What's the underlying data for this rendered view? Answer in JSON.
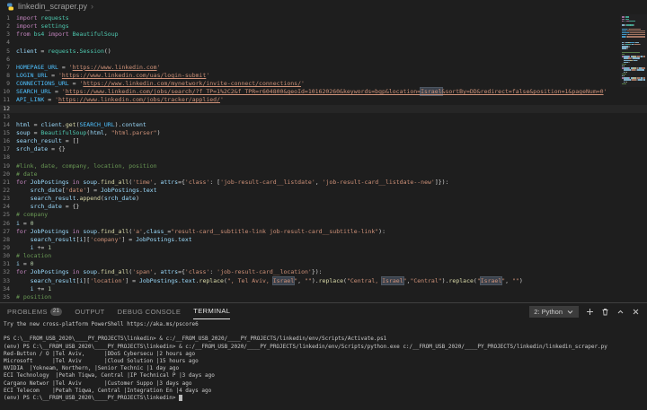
{
  "breadcrumb": {
    "file": "linkedin_scraper.py",
    "separator": "›"
  },
  "colors": {
    "background": "#1e1e1e",
    "keyword": "#c586c0",
    "module": "#4ec9b0",
    "function": "#dcdcaa",
    "variable": "#9cdcfe",
    "constant": "#4fc1ff",
    "string": "#ce9178",
    "number": "#b5cea8",
    "comment": "#6a9955",
    "plain": "#d4d4d4",
    "line_number": "#858585",
    "terminal_text": "#cccccc"
  },
  "editor": {
    "active_line": 12,
    "lines": [
      {
        "n": 1,
        "t": [
          [
            "k",
            "import"
          ],
          [
            "p",
            " "
          ],
          [
            "m",
            "requests"
          ]
        ]
      },
      {
        "n": 2,
        "t": [
          [
            "k",
            "import"
          ],
          [
            "p",
            " "
          ],
          [
            "m",
            "settings"
          ]
        ]
      },
      {
        "n": 3,
        "t": [
          [
            "k",
            "from"
          ],
          [
            "p",
            " "
          ],
          [
            "m",
            "bs4"
          ],
          [
            "p",
            " "
          ],
          [
            "k",
            "import"
          ],
          [
            "p",
            " "
          ],
          [
            "m",
            "BeautifulSoup"
          ]
        ]
      },
      {
        "n": 4,
        "t": []
      },
      {
        "n": 5,
        "t": [
          [
            "v",
            "client"
          ],
          [
            "p",
            " = "
          ],
          [
            "m",
            "requests"
          ],
          [
            "p",
            "."
          ],
          [
            "m",
            "Session"
          ],
          [
            "p",
            "()"
          ]
        ]
      },
      {
        "n": 6,
        "t": []
      },
      {
        "n": 7,
        "t": [
          [
            "c",
            "HOMEPAGE_URL"
          ],
          [
            "p",
            " = "
          ],
          [
            "s",
            "'"
          ],
          [
            "u",
            "https://www.linkedin.com"
          ],
          [
            "s",
            "'"
          ]
        ]
      },
      {
        "n": 8,
        "t": [
          [
            "c",
            "LOGIN_URL"
          ],
          [
            "p",
            " = "
          ],
          [
            "s",
            "'"
          ],
          [
            "u",
            "https://www.linkedin.com/uas/login-submit"
          ],
          [
            "s",
            "'"
          ]
        ]
      },
      {
        "n": 9,
        "t": [
          [
            "c",
            "CONNECTIONS_URL"
          ],
          [
            "p",
            " = "
          ],
          [
            "s",
            "'"
          ],
          [
            "u",
            "https://www.linkedin.com/mynetwork/invite-connect/connections/"
          ],
          [
            "s",
            "'"
          ]
        ]
      },
      {
        "n": 10,
        "t": [
          [
            "c",
            "SEARCH_URL"
          ],
          [
            "p",
            " = "
          ],
          [
            "s",
            "'"
          ],
          [
            "u",
            "https://www.linkedin.com/jobs/search/?f_TP=1%2C2&f_TPR=r604800&geoId=101620260&keywords=bgp&location="
          ],
          [
            "w",
            "Israel"
          ],
          [
            "u",
            "&sortBy=DD&redirect=false&position=1&pageNum=0"
          ],
          [
            "s",
            "'"
          ]
        ]
      },
      {
        "n": 11,
        "t": [
          [
            "c",
            "API_LINK"
          ],
          [
            "p",
            " = "
          ],
          [
            "s",
            "'"
          ],
          [
            "u",
            "https://www.linkedin.com/jobs/tracker/applied/"
          ],
          [
            "s",
            "'"
          ]
        ]
      },
      {
        "n": 12,
        "t": []
      },
      {
        "n": 13,
        "t": []
      },
      {
        "n": 14,
        "t": [
          [
            "v",
            "html"
          ],
          [
            "p",
            " = "
          ],
          [
            "v",
            "client"
          ],
          [
            "p",
            "."
          ],
          [
            "f",
            "get"
          ],
          [
            "p",
            "("
          ],
          [
            "c",
            "SEARCH_URL"
          ],
          [
            "p",
            ")."
          ],
          [
            "v",
            "content"
          ]
        ]
      },
      {
        "n": 15,
        "t": [
          [
            "v",
            "soup"
          ],
          [
            "p",
            " = "
          ],
          [
            "m",
            "BeautifulSoup"
          ],
          [
            "p",
            "("
          ],
          [
            "v",
            "html"
          ],
          [
            "p",
            ", "
          ],
          [
            "s",
            "\"html.parser\""
          ],
          [
            "p",
            ")"
          ]
        ]
      },
      {
        "n": 16,
        "t": [
          [
            "v",
            "search_result"
          ],
          [
            "p",
            " = []"
          ]
        ]
      },
      {
        "n": 17,
        "t": [
          [
            "v",
            "srch_date"
          ],
          [
            "p",
            " = {}"
          ]
        ]
      },
      {
        "n": 18,
        "t": []
      },
      {
        "n": 19,
        "t": [
          [
            "o",
            "#link, date, company, location, position"
          ]
        ]
      },
      {
        "n": 20,
        "t": [
          [
            "o",
            "# date"
          ]
        ]
      },
      {
        "n": 21,
        "t": [
          [
            "k",
            "for"
          ],
          [
            "p",
            " "
          ],
          [
            "v",
            "JobPostings"
          ],
          [
            "p",
            " "
          ],
          [
            "k",
            "in"
          ],
          [
            "p",
            " "
          ],
          [
            "v",
            "soup"
          ],
          [
            "p",
            "."
          ],
          [
            "f",
            "find_all"
          ],
          [
            "p",
            "("
          ],
          [
            "s",
            "'time'"
          ],
          [
            "p",
            ", "
          ],
          [
            "v",
            "attrs"
          ],
          [
            "p",
            "={"
          ],
          [
            "s",
            "'class'"
          ],
          [
            "p",
            ": ["
          ],
          [
            "s",
            "'job-result-card__listdate'"
          ],
          [
            "p",
            ", "
          ],
          [
            "s",
            "'job-result-card__listdate--new'"
          ],
          [
            "p",
            "]}):"
          ]
        ]
      },
      {
        "n": 22,
        "t": [
          [
            "p",
            "    "
          ],
          [
            "v",
            "srch_date"
          ],
          [
            "p",
            "["
          ],
          [
            "s",
            "'date'"
          ],
          [
            "p",
            "] = "
          ],
          [
            "v",
            "JobPostings"
          ],
          [
            "p",
            "."
          ],
          [
            "v",
            "text"
          ]
        ]
      },
      {
        "n": 23,
        "t": [
          [
            "p",
            "    "
          ],
          [
            "v",
            "search_result"
          ],
          [
            "p",
            "."
          ],
          [
            "f",
            "append"
          ],
          [
            "p",
            "("
          ],
          [
            "v",
            "srch_date"
          ],
          [
            "p",
            ")"
          ]
        ]
      },
      {
        "n": 24,
        "t": [
          [
            "p",
            "    "
          ],
          [
            "v",
            "srch_date"
          ],
          [
            "p",
            " = {}"
          ]
        ]
      },
      {
        "n": 25,
        "t": [
          [
            "o",
            "# company"
          ]
        ]
      },
      {
        "n": 26,
        "t": [
          [
            "v",
            "i"
          ],
          [
            "p",
            " = "
          ],
          [
            "n2",
            "0"
          ]
        ]
      },
      {
        "n": 27,
        "t": [
          [
            "k",
            "for"
          ],
          [
            "p",
            " "
          ],
          [
            "v",
            "JobPostings"
          ],
          [
            "p",
            " "
          ],
          [
            "k",
            "in"
          ],
          [
            "p",
            " "
          ],
          [
            "v",
            "soup"
          ],
          [
            "p",
            "."
          ],
          [
            "f",
            "find_all"
          ],
          [
            "p",
            "("
          ],
          [
            "s",
            "'a'"
          ],
          [
            "p",
            ","
          ],
          [
            "v",
            "class_"
          ],
          [
            "p",
            "="
          ],
          [
            "s",
            "\"result-card__subtitle-link job-result-card__subtitle-link\""
          ],
          [
            "p",
            "):"
          ]
        ]
      },
      {
        "n": 28,
        "t": [
          [
            "p",
            "    "
          ],
          [
            "v",
            "search_result"
          ],
          [
            "p",
            "["
          ],
          [
            "v",
            "i"
          ],
          [
            "p",
            "]["
          ],
          [
            "s",
            "'company'"
          ],
          [
            "p",
            "] = "
          ],
          [
            "v",
            "JobPostings"
          ],
          [
            "p",
            "."
          ],
          [
            "v",
            "text"
          ]
        ]
      },
      {
        "n": 29,
        "t": [
          [
            "p",
            "    "
          ],
          [
            "v",
            "i"
          ],
          [
            "p",
            " += "
          ],
          [
            "n2",
            "1"
          ]
        ]
      },
      {
        "n": 30,
        "t": [
          [
            "o",
            "# location"
          ]
        ]
      },
      {
        "n": 31,
        "t": [
          [
            "v",
            "i"
          ],
          [
            "p",
            " = "
          ],
          [
            "n2",
            "0"
          ]
        ]
      },
      {
        "n": 32,
        "t": [
          [
            "k",
            "for"
          ],
          [
            "p",
            " "
          ],
          [
            "v",
            "JobPostings"
          ],
          [
            "p",
            " "
          ],
          [
            "k",
            "in"
          ],
          [
            "p",
            " "
          ],
          [
            "v",
            "soup"
          ],
          [
            "p",
            "."
          ],
          [
            "f",
            "find_all"
          ],
          [
            "p",
            "("
          ],
          [
            "s",
            "'span'"
          ],
          [
            "p",
            ", "
          ],
          [
            "v",
            "attrs"
          ],
          [
            "p",
            "={"
          ],
          [
            "s",
            "'class'"
          ],
          [
            "p",
            ": "
          ],
          [
            "s",
            "'job-result-card__location'"
          ],
          [
            "p",
            "}):"
          ]
        ]
      },
      {
        "n": 33,
        "t": [
          [
            "p",
            "    "
          ],
          [
            "v",
            "search_result"
          ],
          [
            "p",
            "["
          ],
          [
            "v",
            "i"
          ],
          [
            "p",
            "]["
          ],
          [
            "s",
            "'location'"
          ],
          [
            "p",
            "] = "
          ],
          [
            "v",
            "JobPostings"
          ],
          [
            "p",
            "."
          ],
          [
            "v",
            "text"
          ],
          [
            "p",
            "."
          ],
          [
            "f",
            "replace"
          ],
          [
            "p",
            "("
          ],
          [
            "s",
            "\", Tel Aviv, "
          ],
          [
            "h",
            "Israel"
          ],
          [
            "s",
            "\""
          ],
          [
            "p",
            ", "
          ],
          [
            "s",
            "\"\""
          ],
          [
            "p",
            ")."
          ],
          [
            "f",
            "replace"
          ],
          [
            "p",
            "("
          ],
          [
            "s",
            "\"Central, "
          ],
          [
            "h",
            "Israel"
          ],
          [
            "s",
            "\""
          ],
          [
            "p",
            ","
          ],
          [
            "s",
            "\"Central\""
          ],
          [
            "p",
            ")."
          ],
          [
            "f",
            "replace"
          ],
          [
            "p",
            "("
          ],
          [
            "s",
            "\""
          ],
          [
            "h",
            "Israel"
          ],
          [
            "s",
            "\""
          ],
          [
            "p",
            ", "
          ],
          [
            "s",
            "\"\""
          ],
          [
            "p",
            ")"
          ]
        ]
      },
      {
        "n": 34,
        "t": [
          [
            "p",
            "    "
          ],
          [
            "v",
            "i"
          ],
          [
            "p",
            " += "
          ],
          [
            "n2",
            "1"
          ]
        ]
      },
      {
        "n": 35,
        "t": [
          [
            "o",
            "# position"
          ]
        ]
      }
    ]
  },
  "panel": {
    "tabs": [
      {
        "label": "PROBLEMS",
        "badge": "21",
        "active": false
      },
      {
        "label": "OUTPUT",
        "active": false
      },
      {
        "label": "DEBUG CONSOLE",
        "active": false
      },
      {
        "label": "TERMINAL",
        "active": true
      }
    ],
    "shell_selector": "2: Python",
    "icons": [
      "chevron-down",
      "plus",
      "trash",
      "chevron-up",
      "close"
    ]
  },
  "terminal": {
    "lines": [
      {
        "text": "Try the new cross-platform PowerShell https://aka.ms/pscore6"
      },
      {
        "text": ""
      },
      {
        "text": "PS C:\\__FROM_USB_2020\\____PY_PROJECTS\\linkedin> & c:/__FROM_USB_2020/____PY_PROJECTS/linkedin/env/Scripts/Activate.ps1"
      },
      {
        "text": "(env) PS C:\\__FROM_USB_2020\\____PY_PROJECTS\\linkedin> & c:/__FROM_USB_2020/____PY_PROJECTS/linkedin/env/Scripts/python.exe c:/__FROM_USB_2020/____PY_PROJECTS/linkedin/linkedin_scraper.py"
      },
      {
        "text": "Red-Button / O |Tel Aviv,      |DDoS Cybersecu |2 hours ago"
      },
      {
        "text": "Microsoft      |Tel Aviv       |Cloud Solution |15 hours ago"
      },
      {
        "text": "NVIDIA  |Yokneam, Northern, |Senior Technic |1 day ago"
      },
      {
        "text": "ECI Technology  |Petah Tiqwa, Central |IP Technical P |3 days ago"
      },
      {
        "text": "Cargano Networ |Tel Aviv       |Customer Suppo |3 days ago"
      },
      {
        "text": "ECI Telecom    |Petah Tiqwa, Central |Integration En |4 days ago"
      },
      {
        "text": "(env) PS C:\\__FROM_USB_2020\\____PY_PROJECTS\\linkedin> ",
        "cursor": true
      }
    ]
  }
}
